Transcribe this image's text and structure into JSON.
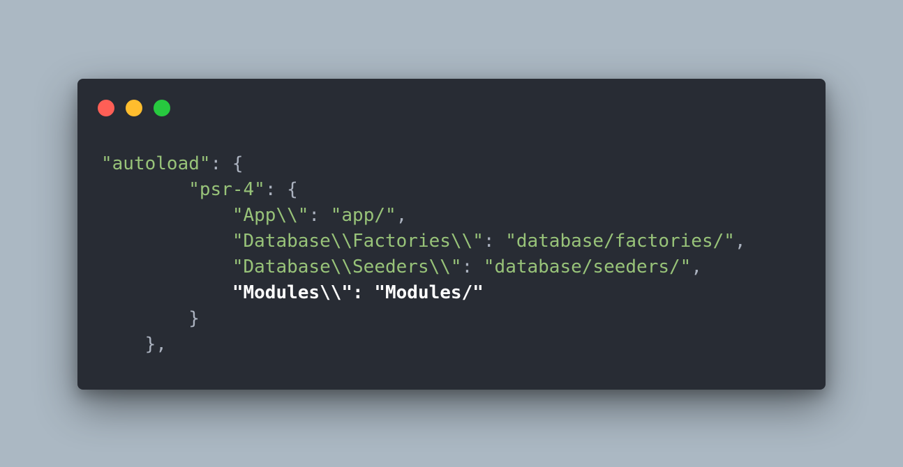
{
  "window_controls": [
    {
      "name": "close",
      "color": "#ff5f56"
    },
    {
      "name": "minimize",
      "color": "#ffbd2e"
    },
    {
      "name": "maximize",
      "color": "#27c93f"
    }
  ],
  "code": {
    "line1": {
      "key": "\"autoload\"",
      "rest": ": {"
    },
    "line2": {
      "indent": "        ",
      "key": "\"psr-4\"",
      "rest": ": {"
    },
    "line3": {
      "indent": "            ",
      "key": "\"App\\\\\"",
      "sep": ": ",
      "value": "\"app/\"",
      "end": ","
    },
    "line4": {
      "indent": "            ",
      "key": "\"Database\\\\Factories\\\\\"",
      "sep": ": ",
      "value": "\"database/factories/\"",
      "end": ","
    },
    "line5": {
      "indent": "            ",
      "key": "\"Database\\\\Seeders\\\\\"",
      "sep": ": ",
      "value": "\"database/seeders/\"",
      "end": ","
    },
    "line6": {
      "indent": "            ",
      "key": "\"Modules\\\\\"",
      "sep": ": ",
      "value": "\"Modules/\"",
      "end": ""
    },
    "line7": {
      "indent": "        ",
      "text": "}"
    },
    "line8": {
      "indent": "    ",
      "text": "},"
    }
  }
}
